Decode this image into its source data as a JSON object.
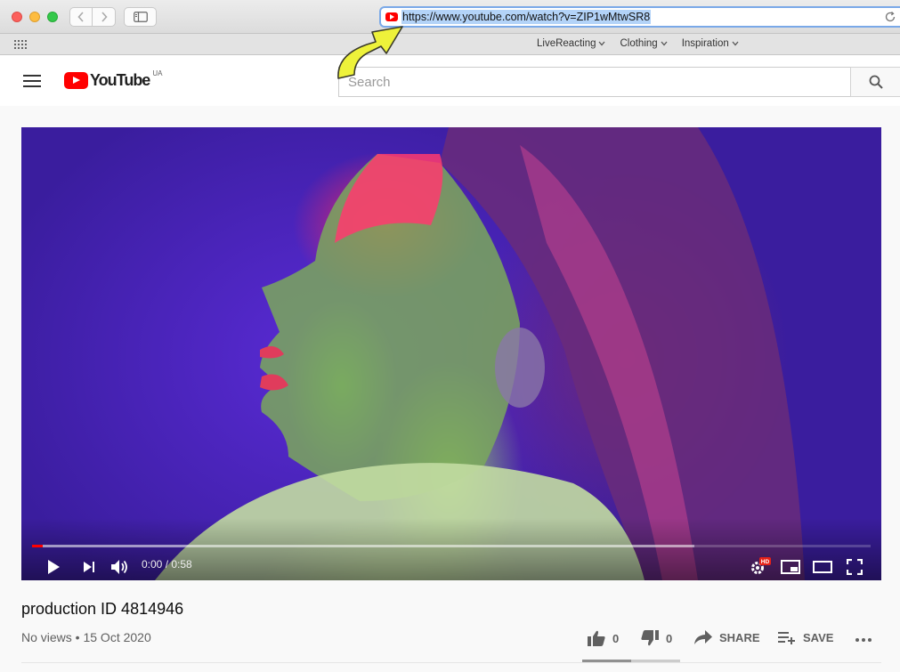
{
  "browser": {
    "url": "https://www.youtube.com/watch?v=ZIP1wMtwSR8",
    "favorites": [
      {
        "label": "LiveReacting"
      },
      {
        "label": "Clothing"
      },
      {
        "label": "Inspiration"
      }
    ],
    "colors": {
      "url_highlight": "#b3d3f8",
      "url_border": "#7aa9e8"
    }
  },
  "youtube": {
    "logo_text": "YouTube",
    "country": "UA",
    "search": {
      "placeholder": "Search",
      "value": ""
    },
    "brand_color": "#ff0000"
  },
  "player": {
    "time": "0:00 / 0:58",
    "played_fraction": 0.013,
    "buffered_fraction": 0.79,
    "quality_badge": "HD",
    "icons": [
      "play-icon",
      "next-icon",
      "volume-icon",
      "settings-icon",
      "miniplayer-icon",
      "theater-icon",
      "fullscreen-icon"
    ]
  },
  "video": {
    "title": "production ID 4814946",
    "meta": "No views • 15 Oct 2020",
    "likes": "0",
    "dislikes": "0",
    "share_label": "SHARE",
    "save_label": "SAVE",
    "like_ratio": 0.5
  }
}
